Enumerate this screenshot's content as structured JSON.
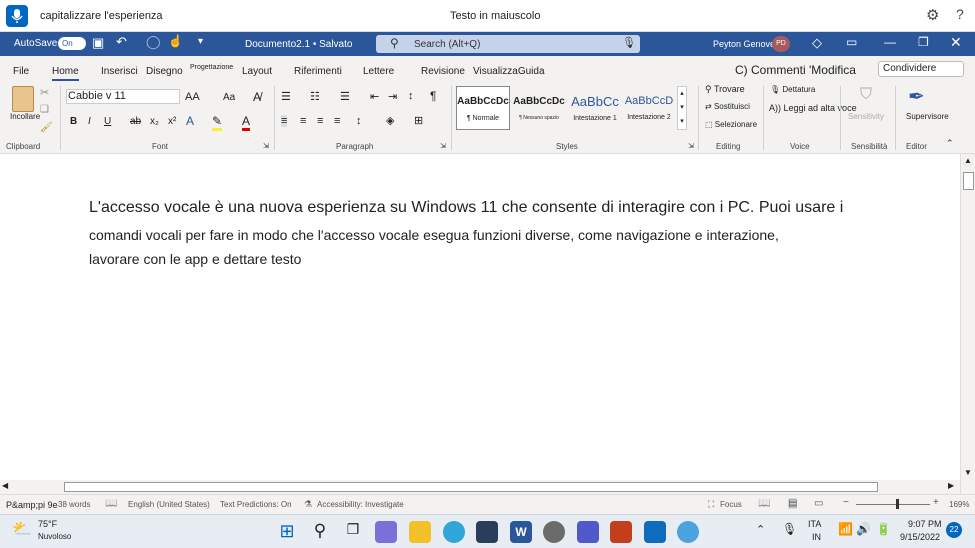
{
  "voice_access": {
    "command": "capitalizzare l'esperienza",
    "status": "Testo in maiuscolo",
    "mic_icon": "microphone-icon"
  },
  "title_bar": {
    "autosave_label": "AutoSave",
    "autosave_state": "On",
    "document_title": "Documento2.1 • Salvato",
    "search_placeholder": "Search (Alt+Q)",
    "user_name": "Peyton Genovese",
    "user_initials": "PD"
  },
  "tabs": [
    "File",
    "Home",
    "Inserisci",
    "Disegno",
    "Progettazione",
    "Layout",
    "Riferimenti",
    "Lettere",
    "Revisione",
    "VisualizzaGuida"
  ],
  "active_tab": "Home",
  "comments_label": "C) Commenti 'Modifica",
  "share_label": "Condividere",
  "clipboard": {
    "paste_label": "Incollare",
    "group": "Clipboard"
  },
  "font": {
    "name": "Cabbie v 11",
    "grow": "AA",
    "case": "Aa",
    "group": "Font",
    "bold": "B",
    "italic": "I",
    "underline": "U",
    "strike": "ab",
    "sub": "x₂",
    "sup": "x²"
  },
  "paragraph": {
    "group": "Paragraph"
  },
  "styles": {
    "group": "Styles",
    "items": [
      {
        "preview": "AaBbCcDc",
        "name": "¶ Normale"
      },
      {
        "preview": "AaBbCcDc",
        "name": "¶ Nessuno spazio"
      },
      {
        "preview": "AaBbCc",
        "name": "Intestazione 1"
      },
      {
        "preview": "AaBbCcD",
        "name": "Intestazione 2"
      }
    ]
  },
  "editing": {
    "find": "Trovare",
    "replace": "Sostituisci",
    "select": "Selezionare",
    "group": "Editing"
  },
  "voice": {
    "dictate": "Dettatura",
    "read_aloud": "Leggi ad alta voce",
    "group": "Voice"
  },
  "sensitivity": {
    "label": "Sensitivity",
    "group": "Sensibilità"
  },
  "editor": {
    "label": "Supervisore",
    "group": "Editor"
  },
  "document": {
    "lines": [
      "L'accesso vocale è una nuova esperienza su Windows 11 che consente di interagire con i PC. Puoi usare i",
      "comandi vocali per fare in modo che l'accesso vocale esegua funzioni diverse, come navigazione e interazione,",
      "lavorare con le app e dettare testo"
    ]
  },
  "status_bar": {
    "page": "P&amp;pi 9e",
    "words": "38 words",
    "language": "English (United States)",
    "predictions": "Text Predictions: On",
    "accessibility": "Accessibility: Investigate",
    "focus": "Focus",
    "zoom": "169%"
  },
  "taskbar": {
    "weather_temp": "75°F",
    "weather_desc": "Nuvoloso",
    "lang_top": "ITA",
    "lang_bottom": "IN",
    "time": "9:07 PM",
    "date": "9/15/2022",
    "notif_count": "22"
  }
}
